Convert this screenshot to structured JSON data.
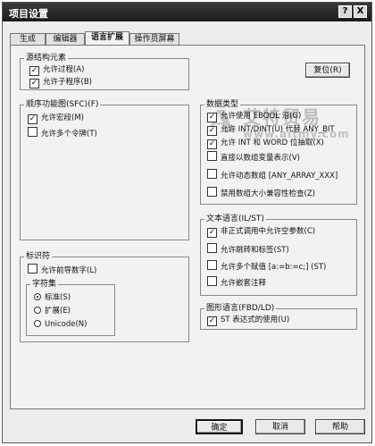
{
  "window": {
    "title": "项目设置",
    "help_btn": "?",
    "close_btn": "X"
  },
  "tabs": [
    "生成",
    "编辑器",
    "语言扩展",
    "操作员屏幕"
  ],
  "groups": {
    "struct": {
      "title": "源结构元素",
      "items": [
        {
          "label": "允许过程(A)",
          "checked": true
        },
        {
          "label": "允许子程序(B)",
          "checked": true
        }
      ]
    },
    "sfc": {
      "title": "顺序功能图(SFC)(F)",
      "items": [
        {
          "label": "允许宏段(M)",
          "checked": true
        },
        {
          "label": "允许多个令牌(T)",
          "checked": false
        }
      ]
    },
    "ident": {
      "title": "标识符",
      "leading_digit": {
        "label": "允许前导数字(L)",
        "checked": false
      },
      "charset": {
        "title": "字符集",
        "options": [
          {
            "label": "标准(S)",
            "selected": true
          },
          {
            "label": "扩展(E)",
            "selected": false
          },
          {
            "label": "Unicode(N)",
            "selected": false
          }
        ]
      }
    },
    "dtype": {
      "title": "数据类型",
      "items": [
        {
          "label": "允许使用 EBOOL 沿(G)",
          "checked": true
        },
        {
          "label": "允许 INT/DINT(U) 代替 ANY_BIT",
          "checked": true
        },
        {
          "label": "允许 INT 和 WORD 位抽取(X)",
          "checked": true
        },
        {
          "label": "直接以数组变量表示(V)",
          "checked": false
        },
        {
          "label": "允许动态数组 [ANY_ARRAY_XXX]",
          "checked": false
        },
        {
          "label": "禁用数组大小兼容性检查(Z)",
          "checked": false
        }
      ]
    },
    "text": {
      "title": "文本语言(IL/ST)",
      "items": [
        {
          "label": "非正式调用中允许空参数(C)",
          "checked": true
        },
        {
          "label": "允许跳转和标签(ST)",
          "checked": false
        },
        {
          "label": "允许多个赋值 [a:=b:=c;] (ST)",
          "checked": false
        },
        {
          "label": "允许嵌套注释",
          "checked": false
        }
      ]
    },
    "graph": {
      "title": "图形语言(FBD/LD)",
      "items": [
        {
          "label": "ST 表达式的使用(U)",
          "checked": true
        }
      ]
    }
  },
  "reset_label": "复位(R)",
  "footer": {
    "ok": "确定",
    "cancel": "取消",
    "help": "帮助"
  },
  "watermark": {
    "letter": "A",
    "name": "艾特贸易",
    "url": "www.aitmy.com"
  }
}
